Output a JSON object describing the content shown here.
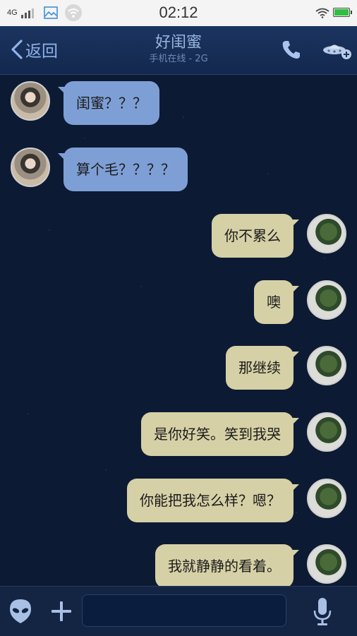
{
  "status_bar": {
    "network": "4G",
    "time": "02:12"
  },
  "header": {
    "back_label": "返回",
    "title": "好闺蜜",
    "subtitle": "手机在线 - 2G"
  },
  "messages": [
    {
      "from": "her",
      "text": "闺蜜？？？"
    },
    {
      "from": "her",
      "text": "算个毛？？？？"
    },
    {
      "from": "me",
      "text": "你不累么"
    },
    {
      "from": "me",
      "text": "噢"
    },
    {
      "from": "me",
      "text": "那继续"
    },
    {
      "from": "me",
      "text": "是你好笑。笑到我哭"
    },
    {
      "from": "me",
      "text": "你能把我怎么样？嗯？"
    },
    {
      "from": "me",
      "text": "我就静静的看着。"
    }
  ],
  "input": {
    "value": "",
    "placeholder": ""
  },
  "icons": {
    "alien": "alien-face-icon",
    "plus": "plus-icon",
    "mic": "microphone-icon",
    "phone": "phone-icon",
    "ufo": "ufo-add-icon"
  },
  "colors": {
    "incoming_bubble": "#7e9fd6",
    "outgoing_bubble": "#d6d0a6",
    "header_bg": "#1b3460",
    "chat_bg": "#0d1a33"
  }
}
